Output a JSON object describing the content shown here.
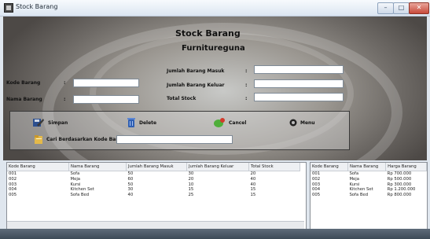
{
  "window": {
    "title": "Stock Barang",
    "controls": [
      "–",
      "□",
      "✕"
    ]
  },
  "header": {
    "title": "Stock Barang",
    "subtitle": "Furnitureguna"
  },
  "form": {
    "kode_label": "Kode Barang",
    "nama_label": "Nama Barang",
    "masuk_label": "Jumlah Barang Masuk",
    "keluar_label": "Jumlah Barang Keluar",
    "total_label": "Total Stock",
    "colon": ":",
    "kode_value": "",
    "nama_value": "",
    "masuk_value": "",
    "keluar_value": "",
    "total_value": ""
  },
  "actions": {
    "simpan": "Simpan",
    "delete": "Delete",
    "cancel": "Cancel",
    "menu": "Menu",
    "search_label": "Cari Berdasarkan Kode Barang",
    "search_value": ""
  },
  "stock_table": {
    "columns": [
      "Kode Barang",
      "Nama Barang",
      "Jumlah Barang Masuk",
      "Jumlah Barang Keluar",
      "Total Stock"
    ],
    "rows": [
      [
        "001",
        "Sofa",
        "50",
        "30",
        "20"
      ],
      [
        "002",
        "Meja",
        "60",
        "20",
        "40"
      ],
      [
        "003",
        "Kursi",
        "50",
        "10",
        "40"
      ],
      [
        "004",
        "Kitchen Set",
        "30",
        "15",
        "15"
      ],
      [
        "005",
        "Sofa Bed",
        "40",
        "25",
        "15"
      ]
    ]
  },
  "price_table": {
    "columns": [
      "Kode Barang",
      "Nama Barang",
      "Harga Barang"
    ],
    "rows": [
      [
        "001",
        "Sofa",
        "Rp 700.000"
      ],
      [
        "002",
        "Meja",
        "Rp 500.000"
      ],
      [
        "003",
        "Kursi",
        "Rp 300.000"
      ],
      [
        "004",
        "Kitchen Set",
        "Rp 1.200.000"
      ],
      [
        "005",
        "Sofa Bed",
        "Rp 800.000"
      ]
    ]
  },
  "colors": {
    "titlebar": "#dbe5f1",
    "close_button": "#c7493a",
    "form_background": "#9a9690",
    "table_header": "#eef0f3"
  },
  "icons": {
    "app": "app-icon",
    "simpan": "save-disk-icon",
    "delete": "trash-icon",
    "cancel": "cancel-icon",
    "menu": "menu-icon",
    "search": "search-folder-icon"
  }
}
